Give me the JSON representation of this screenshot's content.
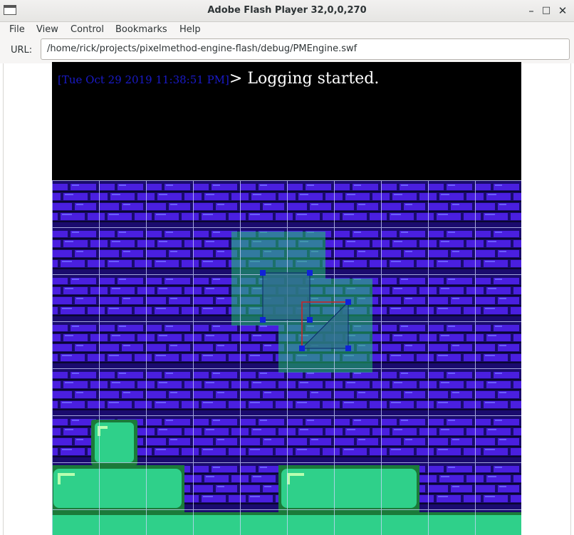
{
  "window": {
    "title": "Adobe Flash Player 32,0,0,270",
    "minimize_glyph": "–",
    "maximize_glyph": "□",
    "close_glyph": "✕"
  },
  "menu": [
    "File",
    "View",
    "Control",
    "Bookmarks",
    "Help"
  ],
  "url": {
    "label": "URL:",
    "value": "/home/rick/projects/pixelmethod-engine-flash/debug/PMEngine.swf"
  },
  "console": {
    "timestamp": "[Tue Oct 29 2019 11:38:51 PM]",
    "message": "> Logging started."
  },
  "colors": {
    "stage_background": "#000000",
    "brick_primary": "#4a1fe0",
    "brick_dark": "#0a0630",
    "brick_highlight": "#6a5cff",
    "green_block": "#2fd08a",
    "green_edge": "#1b7a3a",
    "selection_fill": "#2f6f8a",
    "handle": "#1022d8",
    "red_line": "#d02020",
    "timestamp_text": "#1a1ac8"
  }
}
